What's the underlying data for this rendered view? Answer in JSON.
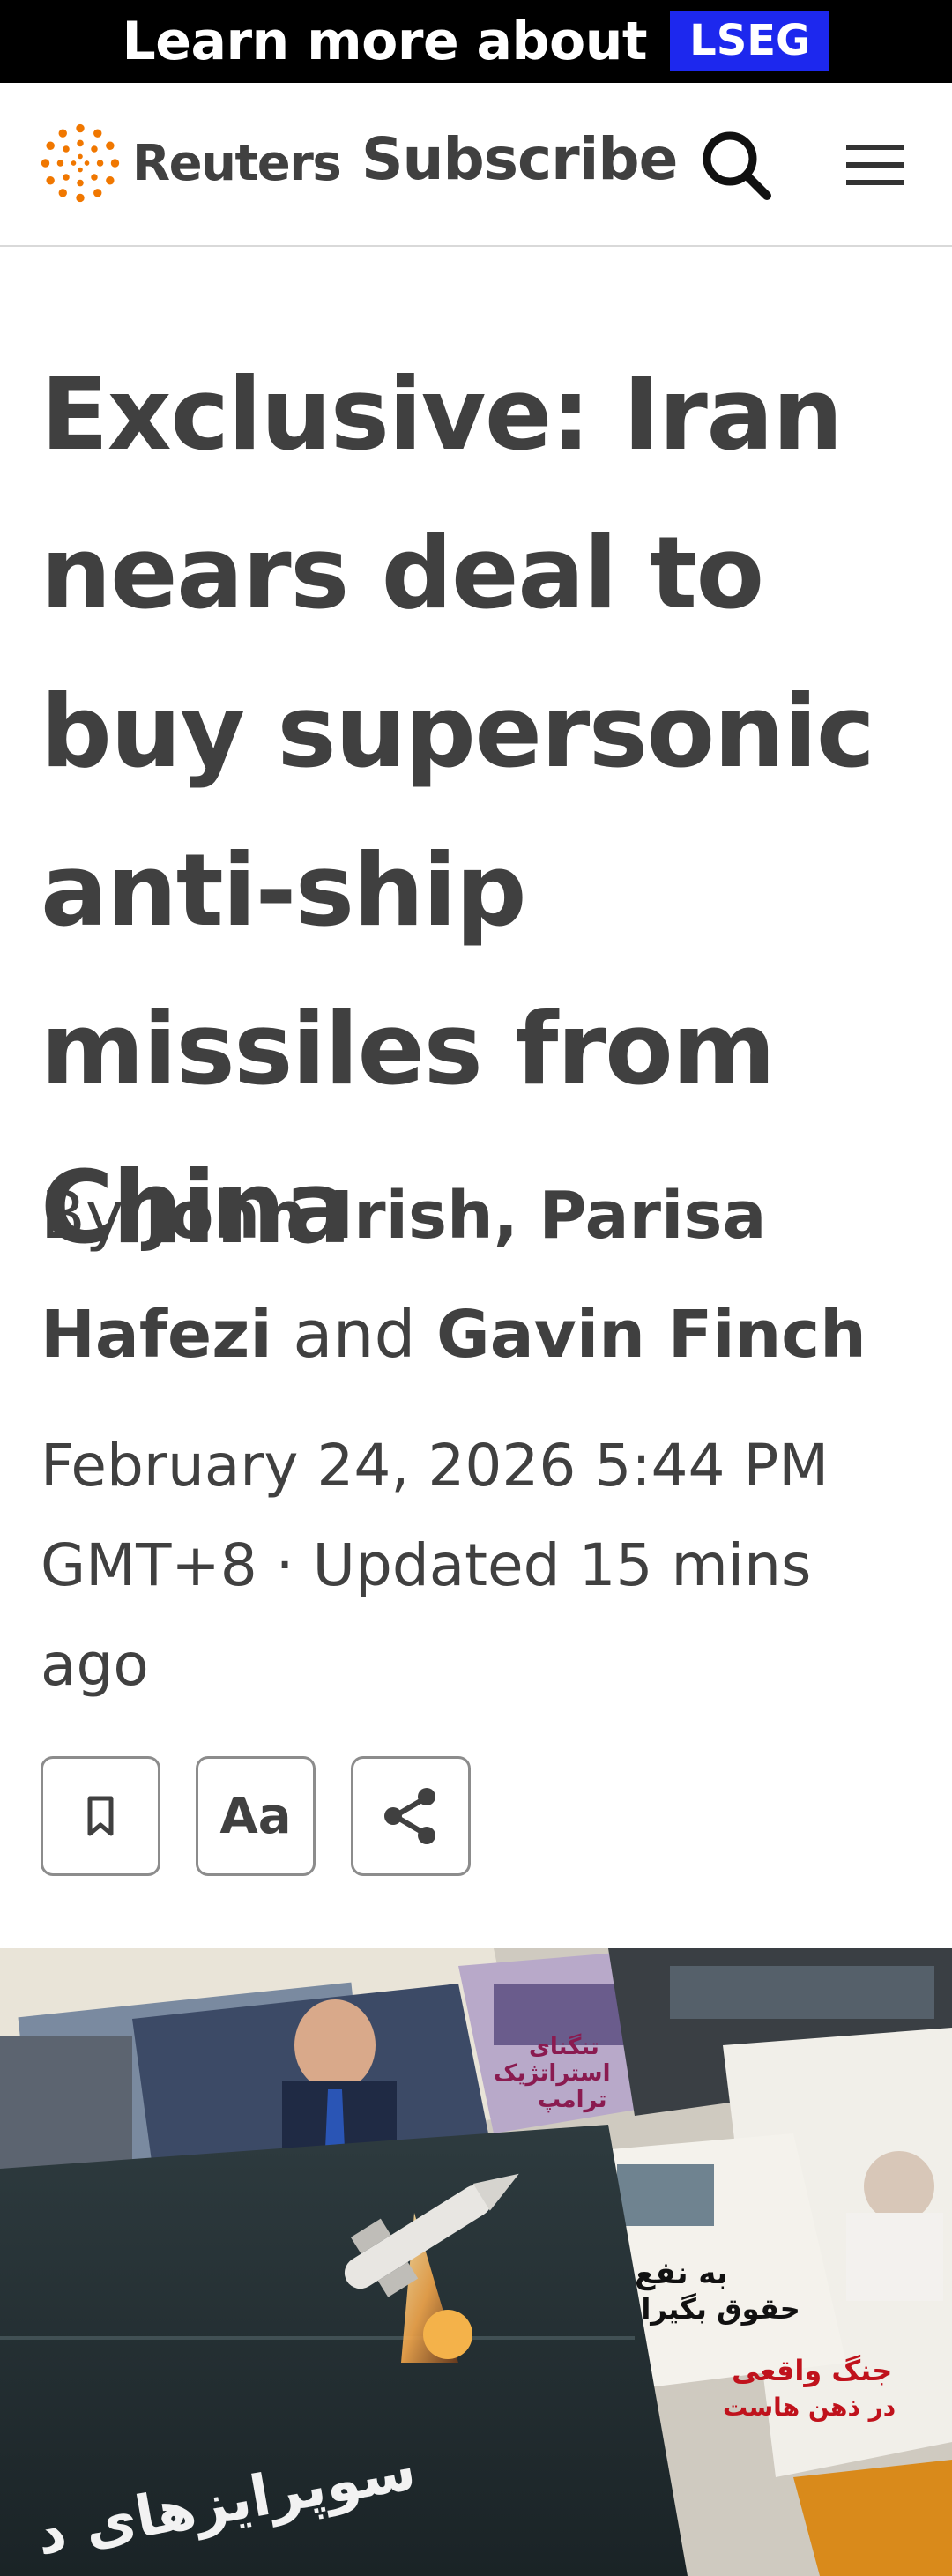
{
  "ad": {
    "text": "Learn more about",
    "badge": "LSEG"
  },
  "header": {
    "logo_text": "Reuters",
    "subscribe_label": "Subscribe",
    "icons": [
      "reuters-logo-icon",
      "search-icon",
      "menu-icon"
    ]
  },
  "article": {
    "headline": "Exclusive: Iran nears deal to buy supersonic anti-ship missiles from China",
    "byline": {
      "prefix": "By",
      "author1": "John Irish",
      "sep": ",",
      "author2": "Parisa Hafezi",
      "and": "and",
      "author3": "Gavin Finch"
    },
    "dateline": "February 24, 2026 5:44 PM GMT+8 · Updated 15 mins ago",
    "actions": {
      "font_label": "Aa",
      "icons": [
        "bookmark-icon",
        "share-icon"
      ]
    }
  },
  "hero": {
    "overlay_texts": [
      "سوپرایزهای د",
      "حقوق بگیران",
      "به نفع",
      "جنگ واقعی",
      "در ذهن هاست",
      "ترامپ",
      "استراتژیک",
      "تنگنای"
    ]
  },
  "colors": {
    "text": "#404040",
    "ad_badge": "#1d28ee",
    "reuters_orange": "#f07700",
    "divider": "#d9d9d9"
  }
}
